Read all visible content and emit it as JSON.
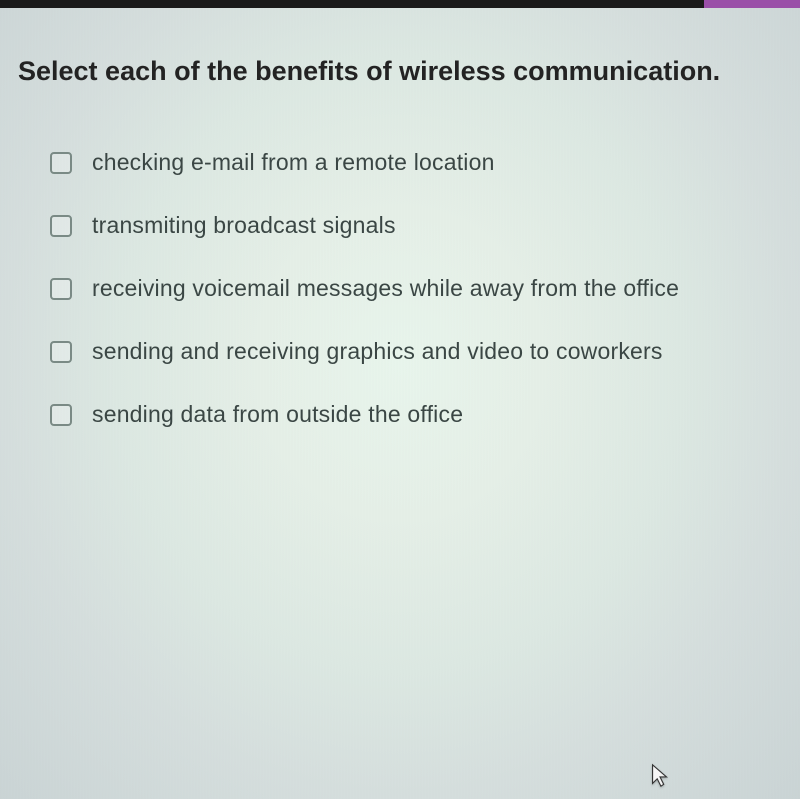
{
  "question": {
    "prompt": "Select each of the benefits of wireless communication."
  },
  "options": [
    {
      "label": "checking e-mail from a remote location",
      "checked": false
    },
    {
      "label": "transmiting broadcast signals",
      "checked": false
    },
    {
      "label": "receiving voicemail messages while away from the office",
      "checked": false
    },
    {
      "label": "sending and receiving graphics and video to coworkers",
      "checked": false
    },
    {
      "label": "sending data from outside the office",
      "checked": false
    }
  ]
}
